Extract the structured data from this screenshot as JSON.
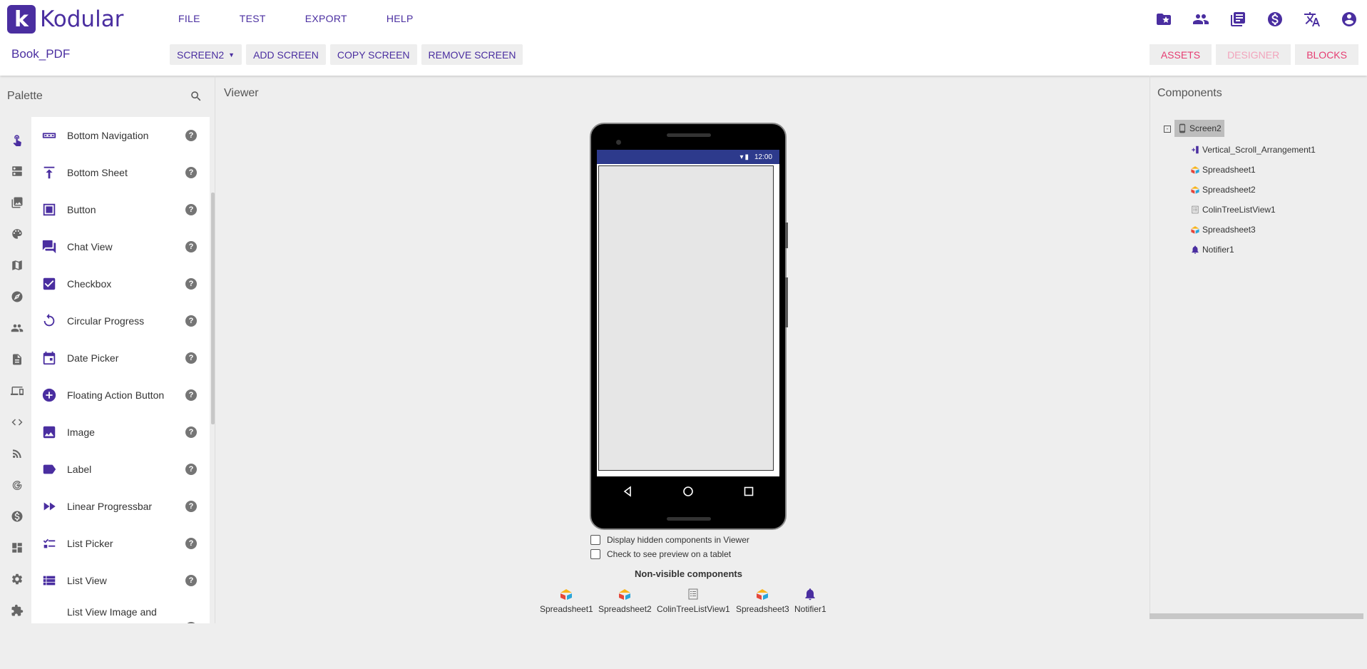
{
  "app": {
    "logo_letter": "k",
    "logo_text": "Kodular",
    "brand_color": "#4a2ea0",
    "accent_color": "#e63d72"
  },
  "menu": [
    "FILE",
    "TEST",
    "EXPORT",
    "HELP"
  ],
  "project": {
    "name": "Book_PDF"
  },
  "screen_toolbar": {
    "screen_select": "SCREEN2",
    "add": "ADD SCREEN",
    "copy": "COPY SCREEN",
    "remove": "REMOVE SCREEN"
  },
  "top_icons": [
    "folder-star-icon",
    "people-icon",
    "library-icon",
    "dollar-icon",
    "translate-icon",
    "account-icon"
  ],
  "view_buttons": {
    "assets": "ASSETS",
    "designer": "DESIGNER",
    "blocks": "BLOCKS"
  },
  "palette": {
    "title": "Palette",
    "categories": [
      "touch-icon",
      "layout-icon",
      "media-icon",
      "drawing-icon",
      "maps-icon",
      "sensors-icon",
      "social-icon",
      "storage-icon",
      "connectivity-icon",
      "code-icon",
      "feed-icon",
      "google-icon",
      "monetization-icon",
      "dashboard-icon",
      "settings-icon",
      "extension-icon"
    ],
    "components": [
      {
        "label": "Bottom Navigation",
        "icon": "bottom-navigation-icon"
      },
      {
        "label": "Bottom Sheet",
        "icon": "bottom-sheet-icon"
      },
      {
        "label": "Button",
        "icon": "button-icon"
      },
      {
        "label": "Chat View",
        "icon": "chat-view-icon"
      },
      {
        "label": "Checkbox",
        "icon": "checkbox-icon"
      },
      {
        "label": "Circular Progress",
        "icon": "circular-progress-icon"
      },
      {
        "label": "Date Picker",
        "icon": "date-picker-icon"
      },
      {
        "label": "Floating Action Button",
        "icon": "floating-action-button-icon"
      },
      {
        "label": "Image",
        "icon": "image-icon"
      },
      {
        "label": "Label",
        "icon": "label-icon"
      },
      {
        "label": "Linear Progressbar",
        "icon": "linear-progressbar-icon"
      },
      {
        "label": "List Picker",
        "icon": "list-picker-icon"
      },
      {
        "label": "List View",
        "icon": "list-view-icon"
      },
      {
        "label": "List View Image and",
        "icon": "list-view-image-icon"
      }
    ],
    "help_glyph": "?"
  },
  "viewer": {
    "title": "Viewer",
    "status_time": "12:00",
    "checkbox_hidden": "Display hidden components in Viewer",
    "checkbox_tablet": "Check to see preview on a tablet",
    "nonvisible_title": "Non-visible components",
    "nonvisible": [
      "Spreadsheet1",
      "Spreadsheet2",
      "ColinTreeListView1",
      "Spreadsheet3",
      "Notifier1"
    ]
  },
  "components_panel": {
    "title": "Components",
    "root": "Screen2",
    "toggle": "-",
    "children": [
      "Vertical_Scroll_Arrangement1",
      "Spreadsheet1",
      "Spreadsheet2",
      "ColinTreeListView1",
      "Spreadsheet3",
      "Notifier1"
    ]
  }
}
